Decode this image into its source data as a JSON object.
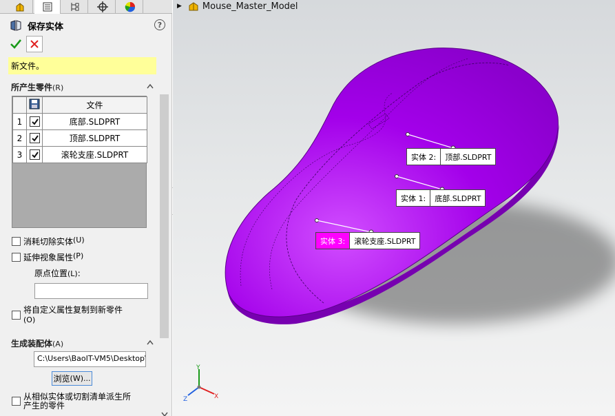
{
  "panel": {
    "tabs": [
      "feature-manager-icon",
      "property-manager-icon",
      "configuration-manager-icon",
      "dimxpert-icon",
      "display-manager-icon"
    ],
    "title": "保存实体",
    "help_glyph": "?",
    "message": "新文件。",
    "resulting_parts": {
      "heading": "所产生零件",
      "heading_key": "(R)",
      "column_file": "文件",
      "rows": [
        {
          "index": "1",
          "file": "底部.SLDPRT",
          "checked": true,
          "selected": false
        },
        {
          "index": "2",
          "file": "顶部.SLDPRT",
          "checked": true,
          "selected": false
        },
        {
          "index": "3",
          "file": "滚轮支座.SLDPRT",
          "checked": true,
          "selected": true
        }
      ]
    },
    "options": {
      "consume_cut": "消耗切除实体",
      "consume_cut_key": "(U)",
      "extend_view": "延伸视象属性",
      "extend_view_key": "(P)",
      "origin_label": "原点位置",
      "origin_key": "(L)",
      "origin_colon": ":",
      "copy_props": "将自定义属性复制到新零件",
      "copy_props_key": "(O)"
    },
    "assembly": {
      "heading": "生成装配体",
      "heading_key": "(A)",
      "path": "C:\\Users\\BaoIT-VM5\\Desktop\\",
      "browse_label": "浏览",
      "browse_key": "(W)...",
      "derived_line1": "从相似实体或切割清单派生所",
      "derived_line2": "产生的零件"
    }
  },
  "viewport": {
    "model_name": "Mouse_Master_Model",
    "callouts": [
      {
        "name": "实体 2:",
        "file": "顶部.SLDPRT",
        "highlight": false
      },
      {
        "name": "实体 1:",
        "file": "底部.SLDPRT",
        "highlight": false
      },
      {
        "name": "实体 3:",
        "file": "滚轮支座.SLDPRT",
        "highlight": true
      }
    ],
    "triad": {
      "x": "X",
      "y": "Y",
      "z": "Z"
    }
  },
  "colors": {
    "body": "#a000e6",
    "highlight": "#ff00ff",
    "message_bg": "#ffff99",
    "ok_green": "#1a9a1a",
    "cancel_red": "#e02020"
  }
}
